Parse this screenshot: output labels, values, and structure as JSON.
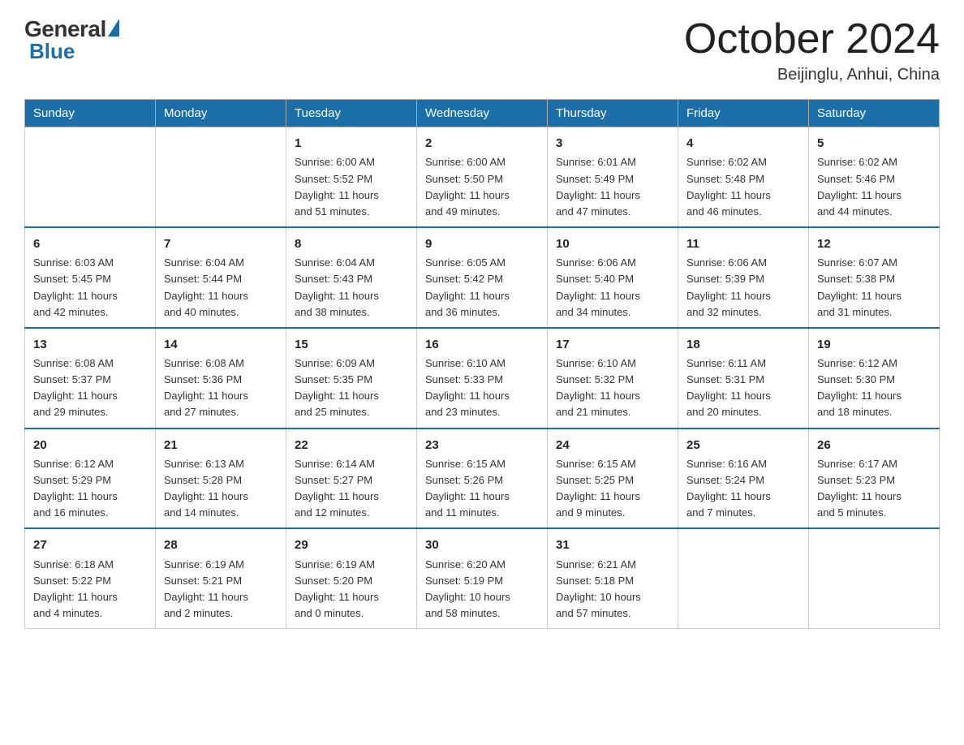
{
  "logo": {
    "general": "General",
    "blue": "Blue"
  },
  "header": {
    "month": "October 2024",
    "location": "Beijinglu, Anhui, China"
  },
  "weekdays": [
    "Sunday",
    "Monday",
    "Tuesday",
    "Wednesday",
    "Thursday",
    "Friday",
    "Saturday"
  ],
  "weeks": [
    [
      {
        "day": "",
        "info": ""
      },
      {
        "day": "",
        "info": ""
      },
      {
        "day": "1",
        "info": "Sunrise: 6:00 AM\nSunset: 5:52 PM\nDaylight: 11 hours\nand 51 minutes."
      },
      {
        "day": "2",
        "info": "Sunrise: 6:00 AM\nSunset: 5:50 PM\nDaylight: 11 hours\nand 49 minutes."
      },
      {
        "day": "3",
        "info": "Sunrise: 6:01 AM\nSunset: 5:49 PM\nDaylight: 11 hours\nand 47 minutes."
      },
      {
        "day": "4",
        "info": "Sunrise: 6:02 AM\nSunset: 5:48 PM\nDaylight: 11 hours\nand 46 minutes."
      },
      {
        "day": "5",
        "info": "Sunrise: 6:02 AM\nSunset: 5:46 PM\nDaylight: 11 hours\nand 44 minutes."
      }
    ],
    [
      {
        "day": "6",
        "info": "Sunrise: 6:03 AM\nSunset: 5:45 PM\nDaylight: 11 hours\nand 42 minutes."
      },
      {
        "day": "7",
        "info": "Sunrise: 6:04 AM\nSunset: 5:44 PM\nDaylight: 11 hours\nand 40 minutes."
      },
      {
        "day": "8",
        "info": "Sunrise: 6:04 AM\nSunset: 5:43 PM\nDaylight: 11 hours\nand 38 minutes."
      },
      {
        "day": "9",
        "info": "Sunrise: 6:05 AM\nSunset: 5:42 PM\nDaylight: 11 hours\nand 36 minutes."
      },
      {
        "day": "10",
        "info": "Sunrise: 6:06 AM\nSunset: 5:40 PM\nDaylight: 11 hours\nand 34 minutes."
      },
      {
        "day": "11",
        "info": "Sunrise: 6:06 AM\nSunset: 5:39 PM\nDaylight: 11 hours\nand 32 minutes."
      },
      {
        "day": "12",
        "info": "Sunrise: 6:07 AM\nSunset: 5:38 PM\nDaylight: 11 hours\nand 31 minutes."
      }
    ],
    [
      {
        "day": "13",
        "info": "Sunrise: 6:08 AM\nSunset: 5:37 PM\nDaylight: 11 hours\nand 29 minutes."
      },
      {
        "day": "14",
        "info": "Sunrise: 6:08 AM\nSunset: 5:36 PM\nDaylight: 11 hours\nand 27 minutes."
      },
      {
        "day": "15",
        "info": "Sunrise: 6:09 AM\nSunset: 5:35 PM\nDaylight: 11 hours\nand 25 minutes."
      },
      {
        "day": "16",
        "info": "Sunrise: 6:10 AM\nSunset: 5:33 PM\nDaylight: 11 hours\nand 23 minutes."
      },
      {
        "day": "17",
        "info": "Sunrise: 6:10 AM\nSunset: 5:32 PM\nDaylight: 11 hours\nand 21 minutes."
      },
      {
        "day": "18",
        "info": "Sunrise: 6:11 AM\nSunset: 5:31 PM\nDaylight: 11 hours\nand 20 minutes."
      },
      {
        "day": "19",
        "info": "Sunrise: 6:12 AM\nSunset: 5:30 PM\nDaylight: 11 hours\nand 18 minutes."
      }
    ],
    [
      {
        "day": "20",
        "info": "Sunrise: 6:12 AM\nSunset: 5:29 PM\nDaylight: 11 hours\nand 16 minutes."
      },
      {
        "day": "21",
        "info": "Sunrise: 6:13 AM\nSunset: 5:28 PM\nDaylight: 11 hours\nand 14 minutes."
      },
      {
        "day": "22",
        "info": "Sunrise: 6:14 AM\nSunset: 5:27 PM\nDaylight: 11 hours\nand 12 minutes."
      },
      {
        "day": "23",
        "info": "Sunrise: 6:15 AM\nSunset: 5:26 PM\nDaylight: 11 hours\nand 11 minutes."
      },
      {
        "day": "24",
        "info": "Sunrise: 6:15 AM\nSunset: 5:25 PM\nDaylight: 11 hours\nand 9 minutes."
      },
      {
        "day": "25",
        "info": "Sunrise: 6:16 AM\nSunset: 5:24 PM\nDaylight: 11 hours\nand 7 minutes."
      },
      {
        "day": "26",
        "info": "Sunrise: 6:17 AM\nSunset: 5:23 PM\nDaylight: 11 hours\nand 5 minutes."
      }
    ],
    [
      {
        "day": "27",
        "info": "Sunrise: 6:18 AM\nSunset: 5:22 PM\nDaylight: 11 hours\nand 4 minutes."
      },
      {
        "day": "28",
        "info": "Sunrise: 6:19 AM\nSunset: 5:21 PM\nDaylight: 11 hours\nand 2 minutes."
      },
      {
        "day": "29",
        "info": "Sunrise: 6:19 AM\nSunset: 5:20 PM\nDaylight: 11 hours\nand 0 minutes."
      },
      {
        "day": "30",
        "info": "Sunrise: 6:20 AM\nSunset: 5:19 PM\nDaylight: 10 hours\nand 58 minutes."
      },
      {
        "day": "31",
        "info": "Sunrise: 6:21 AM\nSunset: 5:18 PM\nDaylight: 10 hours\nand 57 minutes."
      },
      {
        "day": "",
        "info": ""
      },
      {
        "day": "",
        "info": ""
      }
    ]
  ]
}
